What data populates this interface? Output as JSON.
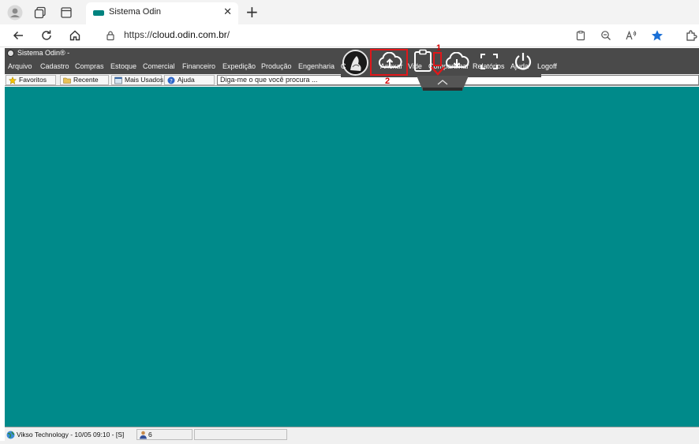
{
  "browser": {
    "tab_title": "Sistema Odin",
    "tab_close": "✕",
    "new_tab": "+",
    "url_scheme": "https://",
    "url_host": "cloud.odin.com.br",
    "url_path": "/"
  },
  "app": {
    "title": "Sistema Odin® -",
    "menu": [
      "Arquivo",
      "Cadastro",
      "Compras",
      "Estoque",
      "Comercial",
      "Financeiro",
      "Expedição",
      "Produção",
      "Engenharia"
    ],
    "toolbar": {
      "favoritos": "Favoritos",
      "recente": "Recente",
      "mais_usados": "Mais Usados",
      "ajuda": "Ajuda",
      "search_placeholder": "Diga-me o que você procura ..."
    },
    "float_toolbar": {
      "partial_c": "C",
      "anexar": "Anexar",
      "vide": "Vide",
      "compartilhar": "Compartilhar",
      "relatorios": "Relatórios",
      "ajuda": "Ajuda",
      "logoff": "Logoff"
    },
    "callouts": {
      "one": "1",
      "two": "2"
    },
    "status": {
      "company": "Vikso Technology - 10/05 09:10 - [S]",
      "users": "6"
    }
  },
  "colors": {
    "teal": "#008a8a",
    "menubar": "#4a4a4a",
    "accent_red": "#e0171a",
    "favorite_star": "#1a6fd6"
  }
}
